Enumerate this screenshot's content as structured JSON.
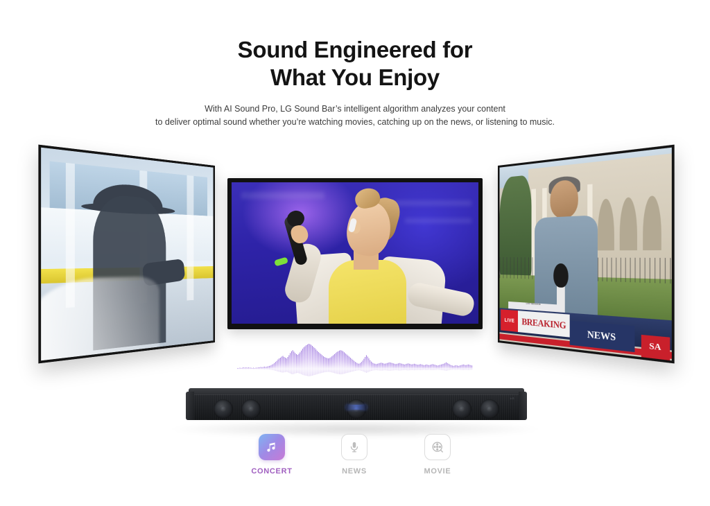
{
  "header": {
    "title_line1": "Sound Engineered for",
    "title_line2": "What You Enjoy",
    "subtitle_line1": "With AI Sound Pro, LG Sound Bar’s intelligent algorithm analyzes your content",
    "subtitle_line2": "to deliver optimal sound whether you’re watching movies, catching up on the news, or listening to music."
  },
  "screens": [
    {
      "id": "left",
      "name": "movie-screen",
      "scene": "movie-silhouette",
      "description": "Silhouette of a person wearing a hat in a bright corridor"
    },
    {
      "id": "center",
      "name": "concert-screen",
      "scene": "concert-singer",
      "description": "Female singer holding a microphone on a blue-lit stage"
    },
    {
      "id": "right",
      "name": "news-screen",
      "scene": "news-broadcast",
      "description": "Reporter with microphone in front of a building",
      "banner": {
        "live": "LIVE",
        "headline_left": "BREAKING",
        "headline_right": "NEWS",
        "corner": "SA",
        "ticker": "LAST MESSAGE"
      }
    }
  ],
  "waveform": {
    "name": "audio-waveform",
    "bar_color_top": "#a07ce0",
    "bar_color_bottom": "#ffffff",
    "bars": [
      2,
      2,
      3,
      2,
      3,
      4,
      3,
      4,
      3,
      4,
      3,
      3,
      2,
      3,
      2,
      3,
      3,
      4,
      4,
      5,
      4,
      5,
      6,
      5,
      6,
      7,
      8,
      9,
      11,
      13,
      16,
      19,
      22,
      26,
      29,
      31,
      34,
      36,
      33,
      31,
      29,
      33,
      38,
      44,
      49,
      52,
      48,
      44,
      41,
      39,
      42,
      46,
      51,
      56,
      60,
      63,
      66,
      68,
      70,
      69,
      67,
      64,
      61,
      58,
      54,
      50,
      47,
      44,
      41,
      38,
      35,
      33,
      31,
      30,
      29,
      30,
      32,
      35,
      38,
      41,
      44,
      47,
      49,
      51,
      52,
      51,
      49,
      46,
      43,
      40,
      37,
      34,
      31,
      28,
      25,
      22,
      19,
      17,
      15,
      14,
      16,
      19,
      23,
      28,
      33,
      38,
      34,
      29,
      24,
      20,
      17,
      15,
      14,
      13,
      14,
      15,
      16,
      17,
      16,
      15,
      14,
      15,
      16,
      17,
      18,
      17,
      16,
      15,
      14,
      13,
      14,
      15,
      16,
      15,
      14,
      13,
      12,
      13,
      14,
      15,
      14,
      13,
      12,
      13,
      14,
      13,
      12,
      11,
      12,
      13,
      12,
      11,
      10,
      11,
      12,
      11,
      10,
      11,
      12,
      13,
      12,
      11,
      10,
      9,
      10,
      11,
      12,
      13,
      14,
      16,
      18,
      16,
      14,
      12,
      10,
      9,
      8,
      9,
      10,
      9,
      8,
      9,
      10,
      11,
      12,
      11,
      10,
      11,
      12,
      11,
      10,
      9
    ]
  },
  "soundbar": {
    "name": "lg-sound-bar",
    "driver_count": 5,
    "display_text": "",
    "brand": "LG"
  },
  "modes": [
    {
      "key": "concert",
      "label": "CONCERT",
      "icon": "music-note-icon",
      "active": true,
      "accent": "#a05fc0"
    },
    {
      "key": "news",
      "label": "NEWS",
      "icon": "microphone-icon",
      "active": false,
      "accent": "#b6b6b6"
    },
    {
      "key": "movie",
      "label": "MOVIE",
      "icon": "film-reel-icon",
      "active": false,
      "accent": "#b6b6b6"
    }
  ],
  "colors": {
    "background": "#ffffff",
    "title": "#141414",
    "subtitle": "#3c3c3c",
    "accent_purple": "#a05fc0",
    "inactive_gray": "#b6b6b6"
  }
}
